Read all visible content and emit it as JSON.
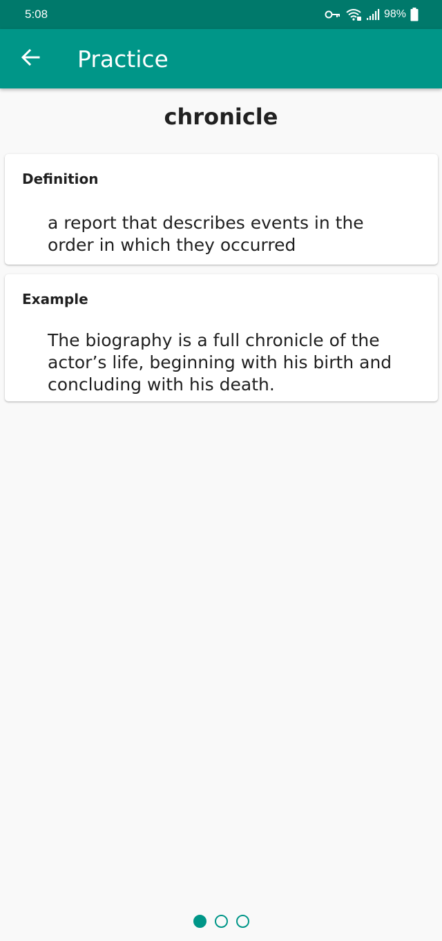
{
  "status_bar": {
    "time": "5:08",
    "battery": "98%"
  },
  "app_bar": {
    "title": "Practice"
  },
  "word": "chronicle",
  "definition": {
    "label": "Definition",
    "text": "a report that describes events in the order in which they occurred"
  },
  "example": {
    "label": "Example",
    "text": "The biography is a full chronicle of the actor’s life, beginning with his birth and concluding with his death."
  },
  "pager": {
    "page_count": 3,
    "current_page": 1
  },
  "colors": {
    "primary": "#009688",
    "primary_dark": "#00796b",
    "background": "#f9f9f9"
  },
  "icons": [
    "arrow-left-icon",
    "key-icon",
    "wifi-icon",
    "signal-icon",
    "battery-icon"
  ]
}
